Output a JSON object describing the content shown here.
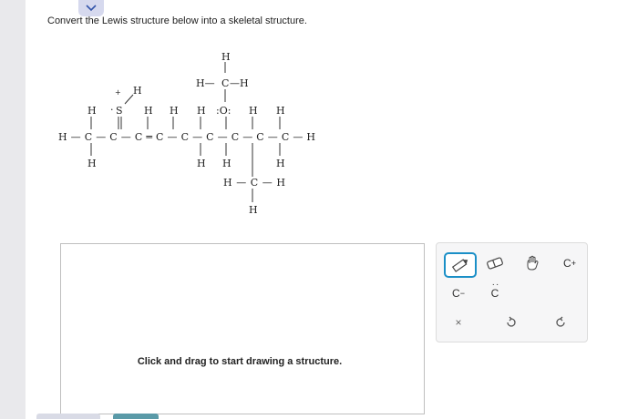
{
  "question": {
    "prompt": "Convert the Lewis structure below into a skeletal structure."
  },
  "molecule": {
    "atoms": {
      "h_top": "H",
      "ch3_left_h": "H—",
      "ch3_c": "C",
      "ch3_right_h": "—H",
      "s_h": "H",
      "h_above_c1": "H",
      "s_charge": "+",
      "s_dots": "·",
      "s_atom": "S",
      "h_above_c4": "H",
      "h_above_c5": "H",
      "h_above_c6": "H",
      "o_atom": ":O:",
      "h_above_c8": "H",
      "h_above_c9": "H",
      "main_chain": "H—C—C—C═C—C—C—C—C—C—H",
      "h_below_c1": "H",
      "h_below_c6": "H",
      "h_below_c7": "H",
      "h_below_c9": "H",
      "ch3b_left": "H—C—H",
      "h_bottom": "H"
    }
  },
  "drawing_area": {
    "hint": "Click and drag to start drawing a structure."
  },
  "toolbox": {
    "carbanion_label": "C",
    "carbanion_charge": "−",
    "radical_label": "C",
    "carbocation_label": "C",
    "carbocation_charge": "+",
    "clear_label": "×"
  }
}
